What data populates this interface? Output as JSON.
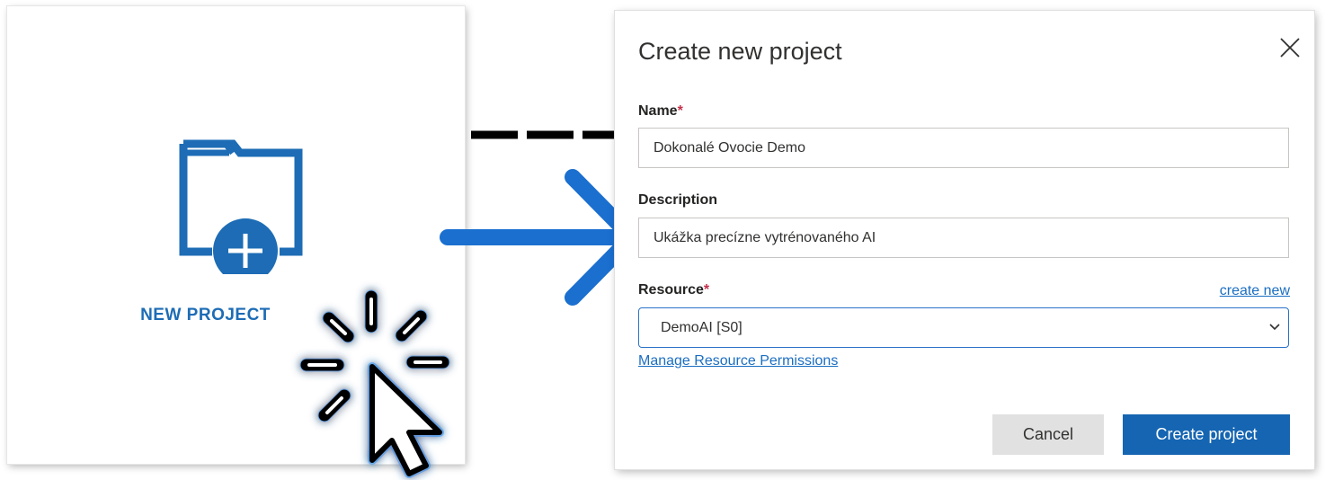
{
  "card": {
    "label": "NEW PROJECT",
    "icon": "folder-plus-icon"
  },
  "dialog": {
    "title": "Create new project",
    "close_icon": "close-icon",
    "name": {
      "label": "Name",
      "required_marker": "*",
      "value": "Dokonalé Ovocie Demo"
    },
    "description": {
      "label": "Description",
      "value": "Ukážka precízne vytrénovaného AI"
    },
    "resource": {
      "label": "Resource",
      "required_marker": "*",
      "create_new_link": "create new",
      "selected": "DemoAI [S0]",
      "manage_link": "Manage Resource Permissions"
    },
    "cancel_label": "Cancel",
    "create_label": "Create project"
  },
  "colors": {
    "accent": "#1565b2",
    "icon_blue": "#1d6cb5",
    "arrow_blue": "#1a6fcf",
    "required": "#c4314b",
    "link": "#1b6ec2"
  }
}
